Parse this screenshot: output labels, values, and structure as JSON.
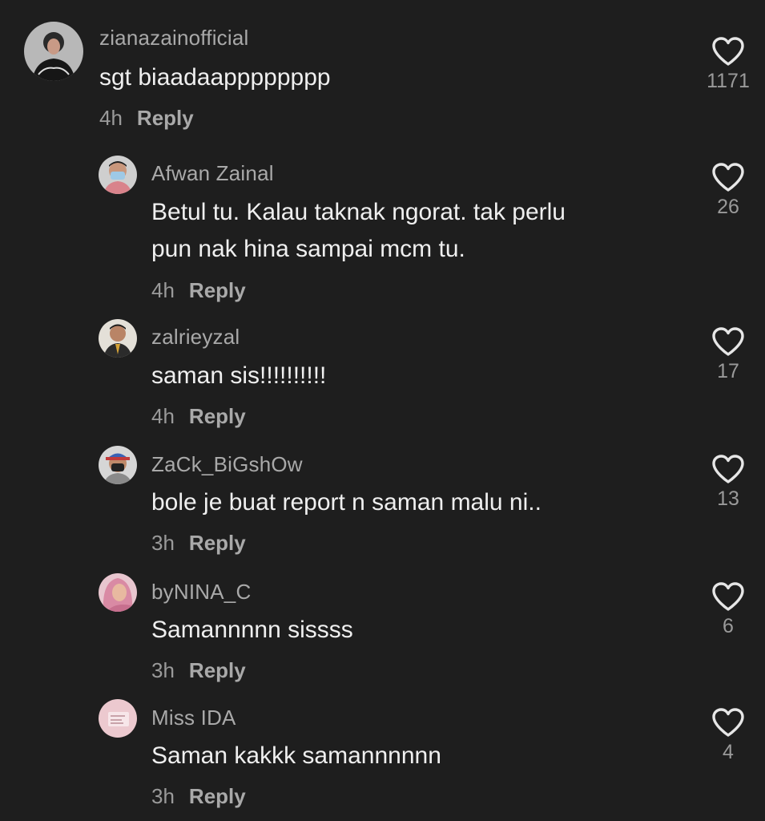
{
  "comments": [
    {
      "username": "zianazainofficial",
      "text": [
        "sgt biaadaapppppppp"
      ],
      "time": "4h",
      "reply": "Reply",
      "likes": "1171",
      "avatar": "avatar-woman-black-outfit"
    },
    {
      "username": "Afwan Zainal",
      "text": [
        "Betul tu. Kalau taknak ngorat. tak perlu",
        "pun nak hina sampai mcm tu."
      ],
      "time": "4h",
      "reply": "Reply",
      "likes": "26",
      "avatar": "avatar-man-mask"
    },
    {
      "username": "zalrieyzal",
      "text": [
        "saman sis!!!!!!!!!!"
      ],
      "time": "4h",
      "reply": "Reply",
      "likes": "17",
      "avatar": "avatar-man-suit"
    },
    {
      "username": "ZaCk_BiGshOw",
      "text": [
        "bole je buat report n saman malu ni.."
      ],
      "time": "3h",
      "reply": "Reply",
      "likes": "13",
      "avatar": "avatar-man-cap-mask"
    },
    {
      "username": "byNINA_C",
      "text": [
        "Samannnnn sissss"
      ],
      "time": "3h",
      "reply": "Reply",
      "likes": "6",
      "avatar": "avatar-woman-pink-hijab"
    },
    {
      "username": "Miss IDA",
      "text": [
        "Saman kakkk samannnnnn"
      ],
      "time": "3h",
      "reply": "Reply",
      "likes": "4",
      "avatar": "avatar-pink-card"
    }
  ]
}
